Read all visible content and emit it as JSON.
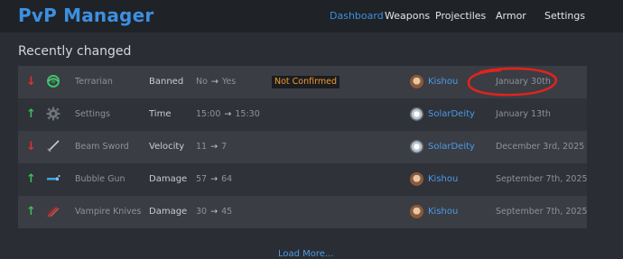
{
  "header": {
    "brand": "PvP Manager",
    "nav": [
      {
        "label": "Dashboard",
        "active": true
      },
      {
        "label": "Weapons",
        "active": false
      },
      {
        "label": "Projectiles",
        "active": false
      },
      {
        "label": "Armor",
        "active": false
      },
      {
        "label": "Settings",
        "active": false
      }
    ]
  },
  "main": {
    "section_title": "Recently changed",
    "rows": [
      {
        "direction": "down",
        "icon": "terrarian-yoyo-icon",
        "item": "Terrarian",
        "field": "Banned",
        "old": "No",
        "new": "Yes",
        "badge": "Not Confirmed",
        "user": "Kishou",
        "date": "January 30th"
      },
      {
        "direction": "up",
        "icon": "gear-icon",
        "item": "Settings",
        "field": "Time",
        "old": "15:00",
        "new": "15:30",
        "badge": "",
        "user": "SolarDeity",
        "date": "January 13th"
      },
      {
        "direction": "down",
        "icon": "beam-sword-icon",
        "item": "Beam Sword",
        "field": "Velocity",
        "old": "11",
        "new": "7",
        "badge": "",
        "user": "SolarDeity",
        "date": "December 3rd, 2025"
      },
      {
        "direction": "up",
        "icon": "bubble-gun-icon",
        "item": "Bubble Gun",
        "field": "Damage",
        "old": "57",
        "new": "64",
        "badge": "",
        "user": "Kishou",
        "date": "September 7th, 2025"
      },
      {
        "direction": "up",
        "icon": "vampire-knives-icon",
        "item": "Vampire Knives",
        "field": "Damage",
        "old": "30",
        "new": "45",
        "badge": "",
        "user": "Kishou",
        "date": "September 7th, 2025"
      }
    ],
    "load_more": "Load More...",
    "arrow_glyphs": {
      "up": "↑",
      "down": "↓",
      "to": "→"
    }
  },
  "colors": {
    "accent": "#3d8fe0",
    "down": "#e03131",
    "up": "#3fbf5a",
    "badge": "#f29a2e",
    "annotation": "#e0231e"
  }
}
